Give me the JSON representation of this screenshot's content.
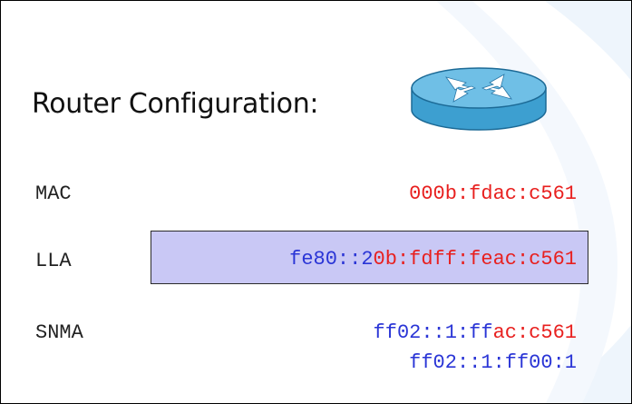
{
  "title": "Router Configuration:",
  "rows": {
    "mac": {
      "label": "MAC",
      "value": "000b:fdac:c561"
    },
    "lla": {
      "label": "LLA",
      "prefix": "fe80::2",
      "middle": "0b:fdff:fe",
      "suffix": "ac:c561"
    },
    "snma": {
      "label": "SNMA",
      "line1_prefix": "ff02::1:ff",
      "line1_suffix": "ac:c561",
      "line2": "ff02::1:ff00:1"
    }
  },
  "colors": {
    "red": "#e8201f",
    "blue": "#2a35d6",
    "highlight": "#c9c8f5",
    "background_arc": "#eef5fc"
  },
  "icons": {
    "router": "router-icon"
  }
}
